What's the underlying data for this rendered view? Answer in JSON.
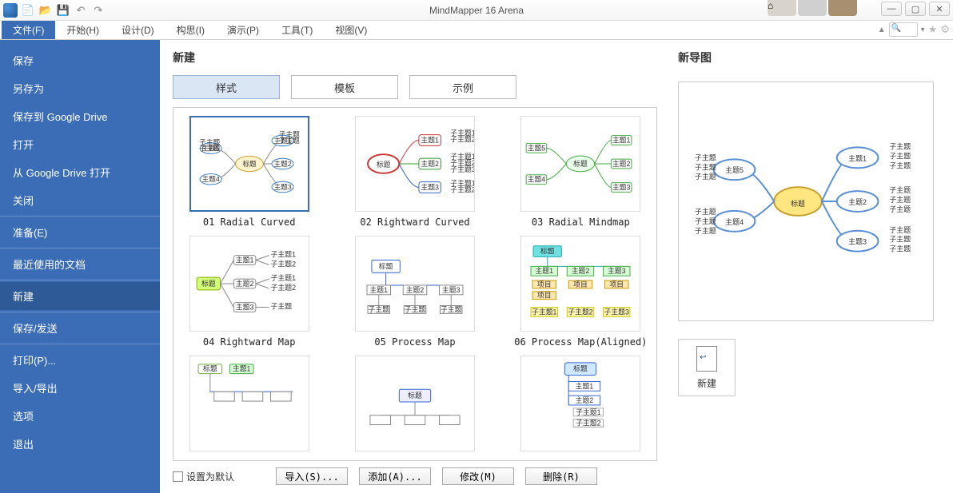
{
  "titlebar": {
    "app_title": "MindMapper 16 Arena"
  },
  "ribbon": {
    "tabs": {
      "file": "文件(F)",
      "home": "开始(H)",
      "design": "设计(D)",
      "idea": "构思(I)",
      "present": "演示(P)",
      "tools": "工具(T)",
      "view": "视图(V)"
    }
  },
  "sidebar": {
    "save": "保存",
    "save_as": "另存为",
    "save_gdrive": "保存到 Google Drive",
    "open": "打开",
    "open_gdrive": "从 Google Drive 打开",
    "close": "关闭",
    "prepare": "准备(E)",
    "recent": "最近使用的文档",
    "new": "新建",
    "save_send": "保存/发送",
    "print": "打印(P)...",
    "import_export": "导入/导出",
    "options": "选项",
    "exit": "退出"
  },
  "new_panel": {
    "title": "新建",
    "tabs": {
      "style": "样式",
      "template": "模板",
      "example": "示例"
    },
    "templates": [
      {
        "id": "t01",
        "label": "01 Radial Curved"
      },
      {
        "id": "t02",
        "label": "02 Rightward Curved"
      },
      {
        "id": "t03",
        "label": "03 Radial Mindmap"
      },
      {
        "id": "t04",
        "label": "04 Rightward Map"
      },
      {
        "id": "t05",
        "label": "05 Process Map"
      },
      {
        "id": "t06",
        "label": "06 Process Map(Aligned)"
      }
    ],
    "set_default": "设置为默认",
    "buttons": {
      "import": "导入(S)...",
      "add": "添加(A)...",
      "modify": "修改(M)",
      "delete": "删除(R)"
    }
  },
  "preview": {
    "title": "新导图",
    "new_label": "新建",
    "map_text": {
      "title": "标题",
      "topic1": "主题1",
      "topic2": "主题2",
      "topic3": "主题3",
      "topic4": "主题4",
      "topic5": "主题5",
      "sub": "子主题"
    }
  }
}
